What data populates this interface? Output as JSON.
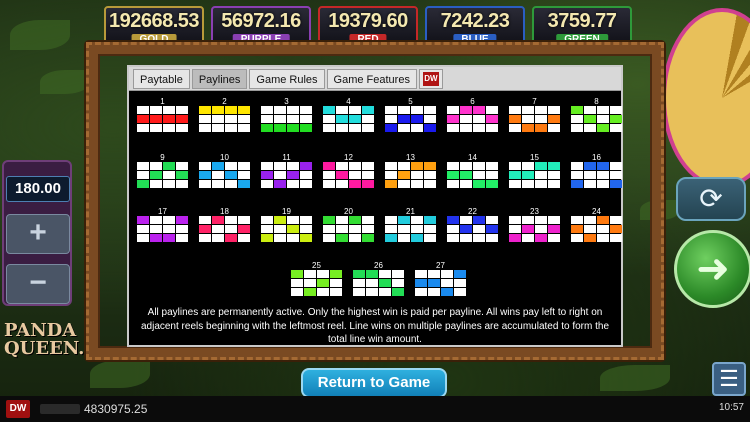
{
  "jackpots": [
    {
      "amount": "192668.53",
      "label": "GOLD",
      "color": "#b89a3a"
    },
    {
      "amount": "56972.16",
      "label": "PURPLE",
      "color": "#8a3fb2"
    },
    {
      "amount": "19379.60",
      "label": "RED",
      "color": "#c52828"
    },
    {
      "amount": "7242.23",
      "label": "BLUE",
      "color": "#2a5ec2"
    },
    {
      "amount": "3759.77",
      "label": "GREEN",
      "color": "#2e9a3a"
    }
  ],
  "tabs": [
    {
      "label": "Paytable",
      "active": false
    },
    {
      "label": "Paylines",
      "active": true
    },
    {
      "label": "Game Rules",
      "active": false
    },
    {
      "label": "Game Features",
      "active": false
    }
  ],
  "logo_tab": {
    "icon": "dw-logo-icon",
    "text": "DW"
  },
  "paylines": [
    {
      "n": "1",
      "color": "#ff1a1a",
      "rows": [
        1,
        1,
        1,
        1
      ]
    },
    {
      "n": "2",
      "color": "#ffe600",
      "rows": [
        0,
        0,
        0,
        0
      ]
    },
    {
      "n": "3",
      "color": "#22dd22",
      "rows": [
        2,
        2,
        2,
        2
      ]
    },
    {
      "n": "4",
      "color": "#22dddd",
      "rows": [
        0,
        1,
        1,
        0
      ]
    },
    {
      "n": "5",
      "color": "#1a1aee",
      "rows": [
        2,
        1,
        1,
        2
      ]
    },
    {
      "n": "6",
      "color": "#ff33cc",
      "rows": [
        1,
        0,
        0,
        1
      ]
    },
    {
      "n": "7",
      "color": "#ff7a10",
      "rows": [
        1,
        2,
        2,
        1
      ]
    },
    {
      "n": "8",
      "color": "#66ee22",
      "rows": [
        0,
        1,
        2,
        1
      ]
    },
    {
      "n": "9",
      "color": "#22dd55",
      "rows": [
        2,
        1,
        0,
        1
      ]
    },
    {
      "n": "10",
      "color": "#1aa8ee",
      "rows": [
        1,
        0,
        1,
        2
      ]
    },
    {
      "n": "11",
      "color": "#9922ee",
      "rows": [
        1,
        2,
        1,
        0
      ]
    },
    {
      "n": "12",
      "color": "#ff1aa0",
      "rows": [
        0,
        1,
        2,
        2
      ]
    },
    {
      "n": "13",
      "color": "#ffa010",
      "rows": [
        2,
        1,
        0,
        0
      ]
    },
    {
      "n": "14",
      "color": "#22ee66",
      "rows": [
        1,
        1,
        2,
        2
      ]
    },
    {
      "n": "15",
      "color": "#22eebb",
      "rows": [
        1,
        1,
        0,
        0
      ]
    },
    {
      "n": "16",
      "color": "#2266ee",
      "rows": [
        2,
        0,
        0,
        2
      ]
    },
    {
      "n": "17",
      "color": "#bb22ee",
      "rows": [
        0,
        2,
        2,
        0
      ]
    },
    {
      "n": "18",
      "color": "#ff2266",
      "rows": [
        1,
        0,
        2,
        1
      ]
    },
    {
      "n": "19",
      "color": "#ccee11",
      "rows": [
        2,
        0,
        1,
        2
      ]
    },
    {
      "n": "20",
      "color": "#33dd33",
      "rows": [
        0,
        2,
        0,
        2
      ]
    },
    {
      "n": "21",
      "color": "#22ccdd",
      "rows": [
        2,
        0,
        2,
        0
      ]
    },
    {
      "n": "22",
      "color": "#2233ee",
      "rows": [
        0,
        1,
        0,
        1
      ]
    },
    {
      "n": "23",
      "color": "#ee22cc",
      "rows": [
        2,
        1,
        2,
        1
      ]
    },
    {
      "n": "24",
      "color": "#ff7a10",
      "rows": [
        1,
        2,
        0,
        1
      ]
    },
    {
      "n": "25",
      "color": "#77ee22",
      "rows": [
        0,
        2,
        1,
        0
      ]
    },
    {
      "n": "26",
      "color": "#22dd55",
      "rows": [
        0,
        0,
        1,
        2
      ]
    },
    {
      "n": "27",
      "color": "#1a8aee",
      "rows": [
        1,
        1,
        2,
        0
      ]
    }
  ],
  "description": "All paylines are permanently active. Only the highest win is paid per payline. All wins pay left to right on adjacent reels beginning with the leftmost reel. Line wins on multiple paylines are accumulated to form the total line win amount.",
  "bet": {
    "value": "180.00",
    "plus": "+",
    "minus": "−"
  },
  "game_logo": {
    "line1": "PANDA",
    "line2": "QUEEN."
  },
  "return_label": "Return to Game",
  "balance": "4830975.25",
  "clock": "10:57",
  "icons": {
    "refresh": "refresh-icon",
    "spin": "spin-arrow-icon",
    "menu": "menu-icon"
  }
}
